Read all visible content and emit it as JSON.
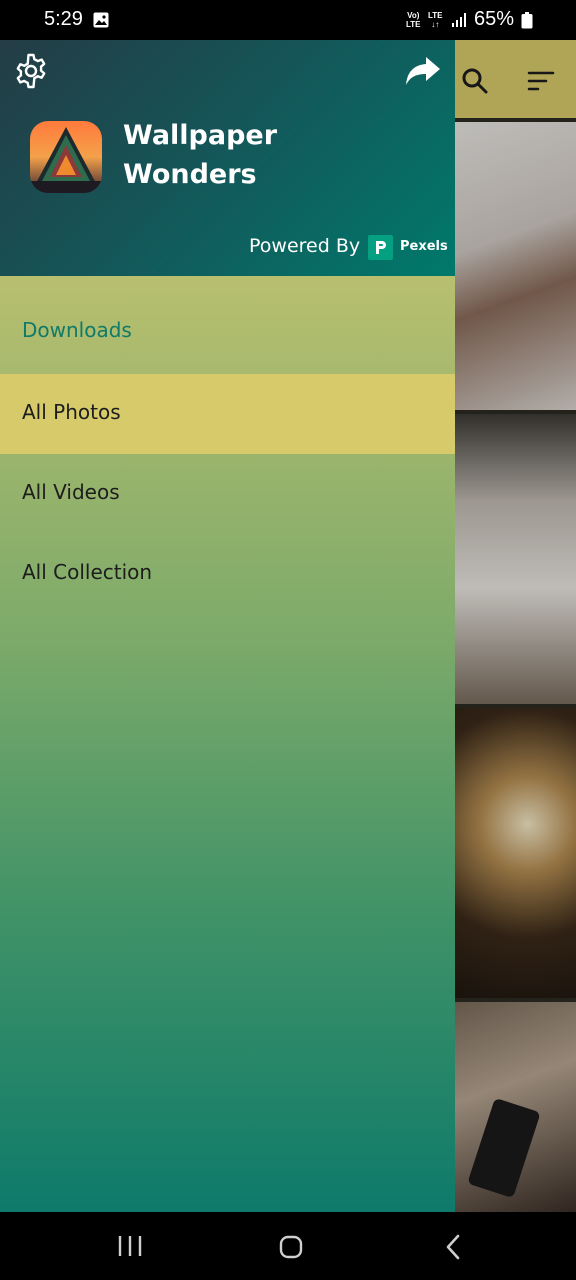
{
  "status_bar": {
    "time": "5:29",
    "network_top": "Vo)",
    "network_bottom": "LTE",
    "lte_top": "LTE",
    "lte_bottom": "↓↑",
    "battery": "65%"
  },
  "drawer": {
    "app_title_line1": "Wallpaper",
    "app_title_line2": "Wonders",
    "powered_by": "Powered By",
    "pexels": "Pexels",
    "menu": [
      {
        "label": "Downloads",
        "selected": false,
        "color": "#0f7a68"
      },
      {
        "label": "All Photos",
        "selected": true
      },
      {
        "label": "All Videos",
        "selected": false
      },
      {
        "label": "All Collection",
        "selected": false
      }
    ]
  },
  "colors": {
    "header_dark": "#243c45",
    "header_teal": "#00796b",
    "selected_item": "#d6ca6a",
    "accent_text": "#0f7a68",
    "bg_app_header": "#d7c86a"
  },
  "icons": {
    "settings": "gear-icon",
    "share": "share-icon",
    "search": "search-icon",
    "sort": "sort-icon"
  }
}
